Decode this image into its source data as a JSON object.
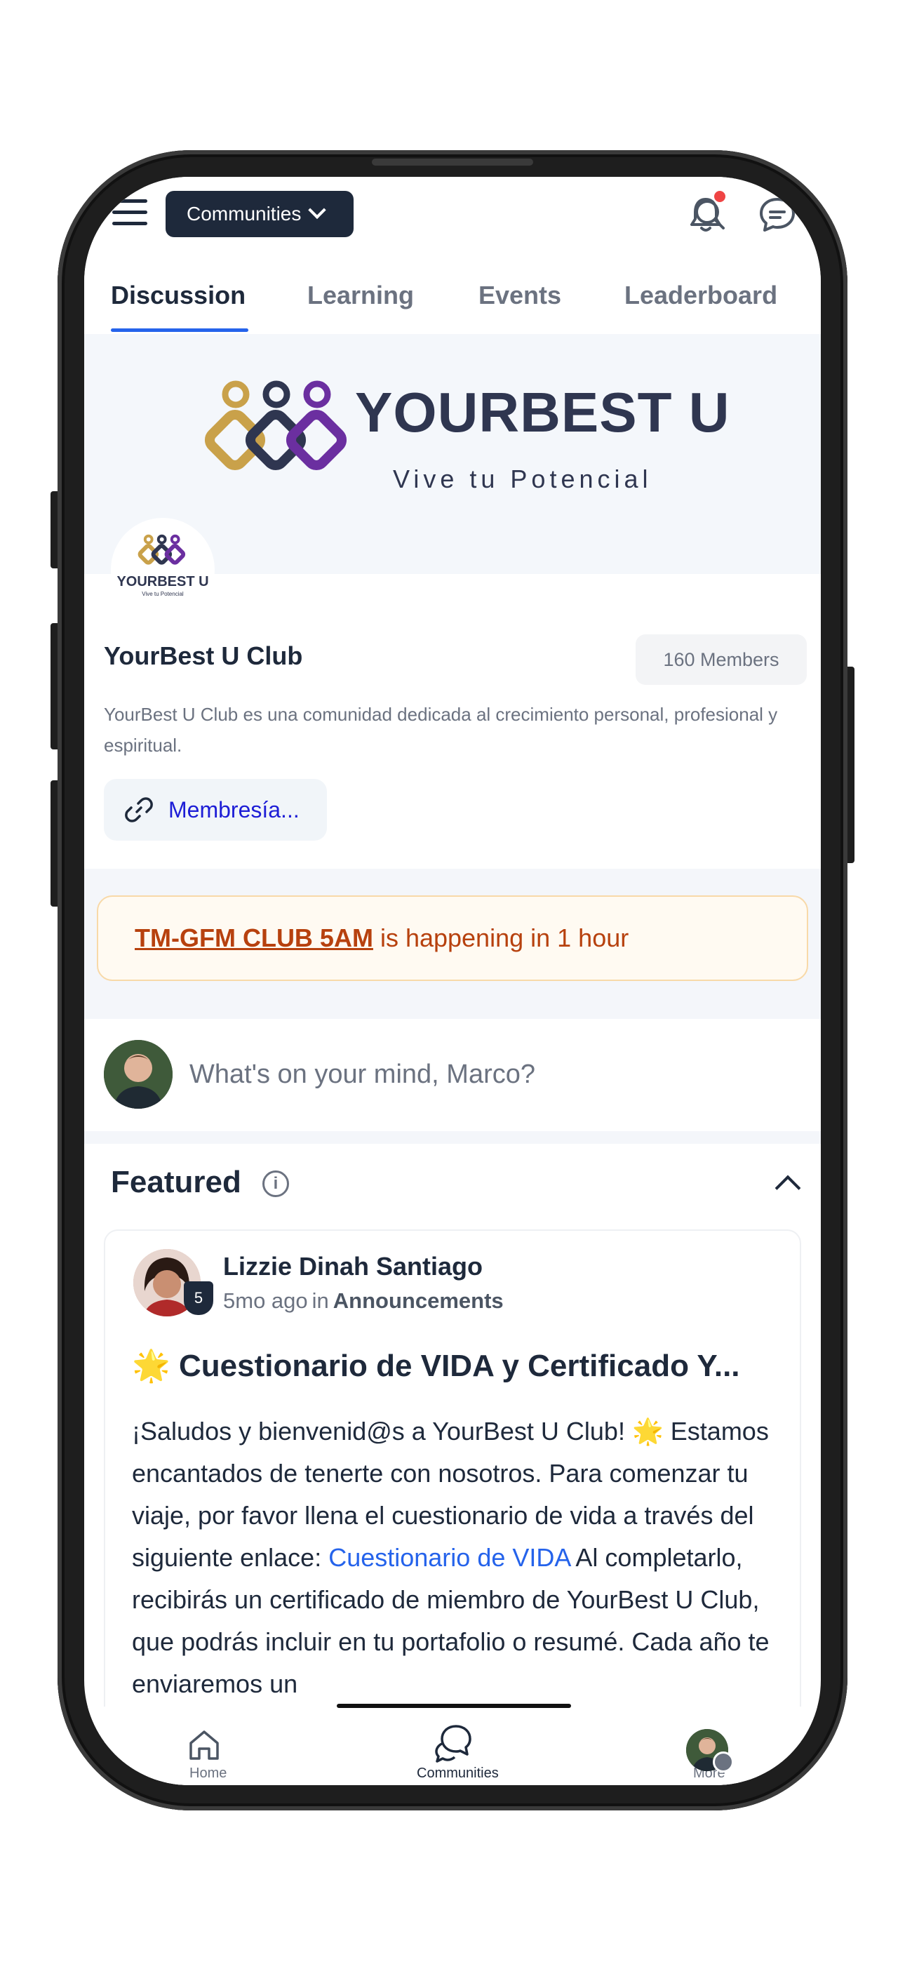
{
  "topbar": {
    "communities_label": "Communities"
  },
  "tabs": [
    "Discussion",
    "Learning",
    "Events",
    "Leaderboard"
  ],
  "banner": {
    "logo_title": "YOURBEST U",
    "logo_subtitle": "Vive tu Potencial",
    "avatar_title": "YOURBEST U",
    "avatar_subtitle": "Vive tu Potencial"
  },
  "club": {
    "name": "YourBest U Club",
    "members": "160 Members",
    "description": "YourBest U Club es una comunidad dedicada al crecimiento personal, profesional y espiritual.",
    "membership_link": "Membresía..."
  },
  "event_alert": {
    "event_name": "TM-GFM CLUB 5AM",
    "text": "is happening in 1 hour"
  },
  "composer": {
    "placeholder": "What's on your mind, Marco?"
  },
  "featured": {
    "title": "Featured",
    "post": {
      "author": "Lizzie Dinah Santiago",
      "level": "5",
      "time": "5mo ago",
      "in_label": "in",
      "space": "Announcements",
      "title": "🌟 Cuestionario de VIDA y Certificado Y...",
      "body_part1": "¡Saludos y bienvenid@s a YourBest U Club! 🌟 Estamos encantados de tenerte con nosotros. Para comenzar tu viaje, por favor llena el cuestionario de vida a través del siguiente enlace: ",
      "body_link": "Cuestionario de VIDA",
      "body_part2": " Al completarlo, recibirás un certificado de miembro de YourBest U Club, que podrás incluir en tu portafolio o resumé. Cada año te enviaremos un"
    }
  },
  "bottom_nav": {
    "home": "Home",
    "communities": "Communities",
    "more": "More"
  },
  "colors": {
    "accent": "#2563eb",
    "dark": "#1e293b",
    "alert_text": "#b7410e",
    "notification_dot": "#ef4444"
  }
}
